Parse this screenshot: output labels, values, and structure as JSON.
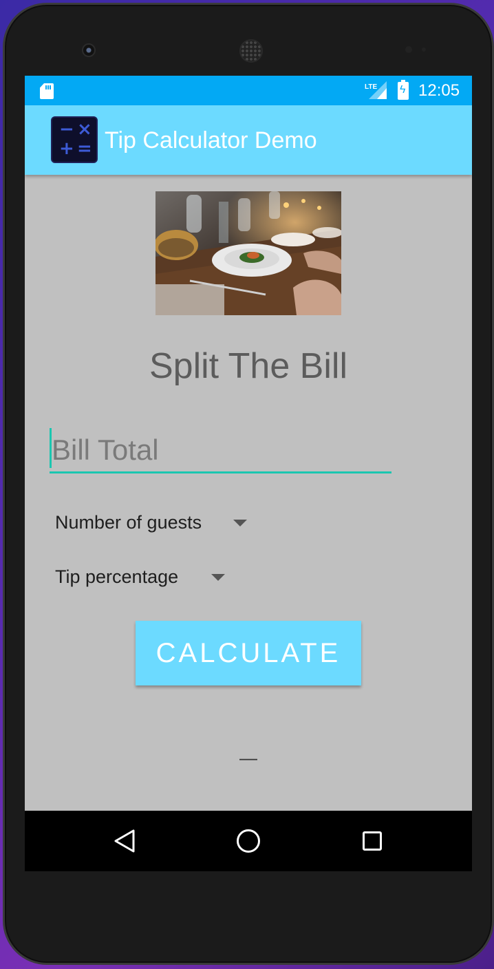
{
  "status_bar": {
    "network_label": "LTE",
    "time": "12:05",
    "color": "#03a9f4"
  },
  "app_bar": {
    "title": "Tip Calculator Demo",
    "color": "#6cdaff",
    "icon_name": "calculator-icon"
  },
  "main": {
    "photo_icon_name": "restaurant-photo",
    "heading": "Split The Bill",
    "bill_input": {
      "value": "",
      "placeholder": "Bill Total",
      "accent_color": "#1ac6b0"
    },
    "guests_spinner": {
      "label": "Number of guests"
    },
    "tip_spinner": {
      "label": "Tip percentage"
    },
    "calculate_button": {
      "label": "CALCULATE"
    },
    "result_text": "—"
  },
  "nav_bar": {
    "back_icon": "back-icon",
    "home_icon": "home-icon",
    "recents_icon": "recents-icon"
  }
}
